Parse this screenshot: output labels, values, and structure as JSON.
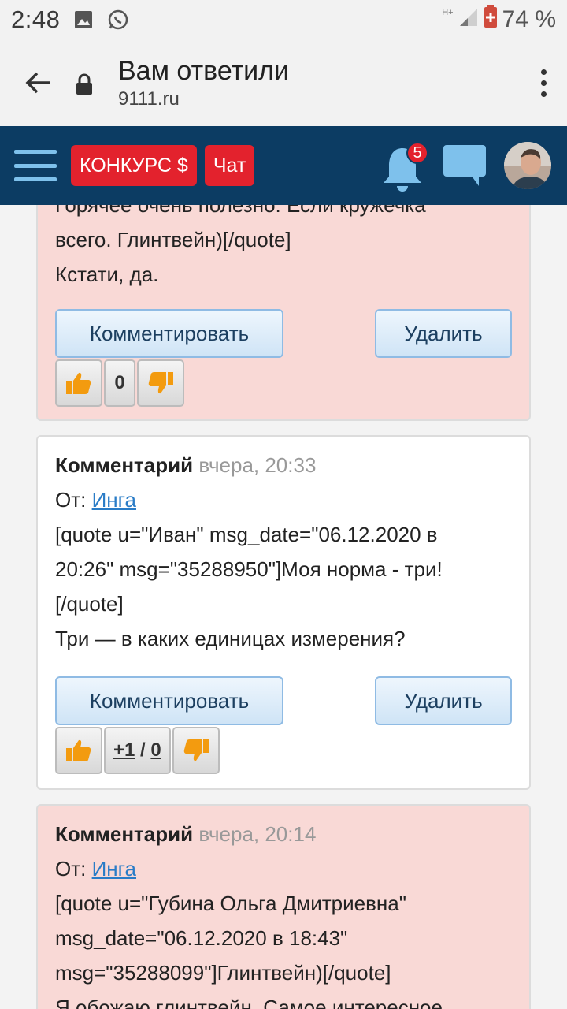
{
  "status": {
    "time": "2:48",
    "battery": "74 %",
    "net": "H+"
  },
  "browser": {
    "title": "Вам ответили",
    "url": "9111.ru"
  },
  "header": {
    "contest_label": "КОНКУРС $",
    "chat_label": "Чат",
    "notif_count": "5"
  },
  "cards": [
    {
      "lines": [
        "Горячее очень полезно. Если кружечка",
        "всего. Глинтвейн)[/quote]",
        "Кстати, да."
      ],
      "comment_btn": "Комментировать",
      "delete_btn": "Удалить",
      "votes": "0"
    },
    {
      "title": "Комментарий",
      "date": "вчера, 20:33",
      "from_label": "От: ",
      "from_name": "Инга",
      "lines": [
        "[quote u=\"Иван\" msg_date=\"06.12.2020 в",
        "20:26\" msg=\"35288950\"]Моя норма - три!",
        "[/quote]",
        "Три — в каких единицах измерения?"
      ],
      "comment_btn": "Комментировать",
      "delete_btn": "Удалить",
      "votes_plus": "+1",
      "votes_sep": " / ",
      "votes_minus": "0"
    },
    {
      "title": "Комментарий",
      "date": "вчера, 20:14",
      "from_label": "От: ",
      "from_name": "Инга",
      "lines": [
        "[quote u=\"Губина Ольга Дмитриевна\"",
        "msg_date=\"06.12.2020 в 18:43\"",
        "msg=\"35288099\"]Глинтвейн)[/quote]",
        "Я обожаю глинтвейн. Самое интересное"
      ]
    }
  ],
  "colors": {
    "header_bg": "#0c3c63",
    "accent_red": "#e3222d",
    "card_pink": "#f9d9d6",
    "link": "#2a7cc7"
  }
}
